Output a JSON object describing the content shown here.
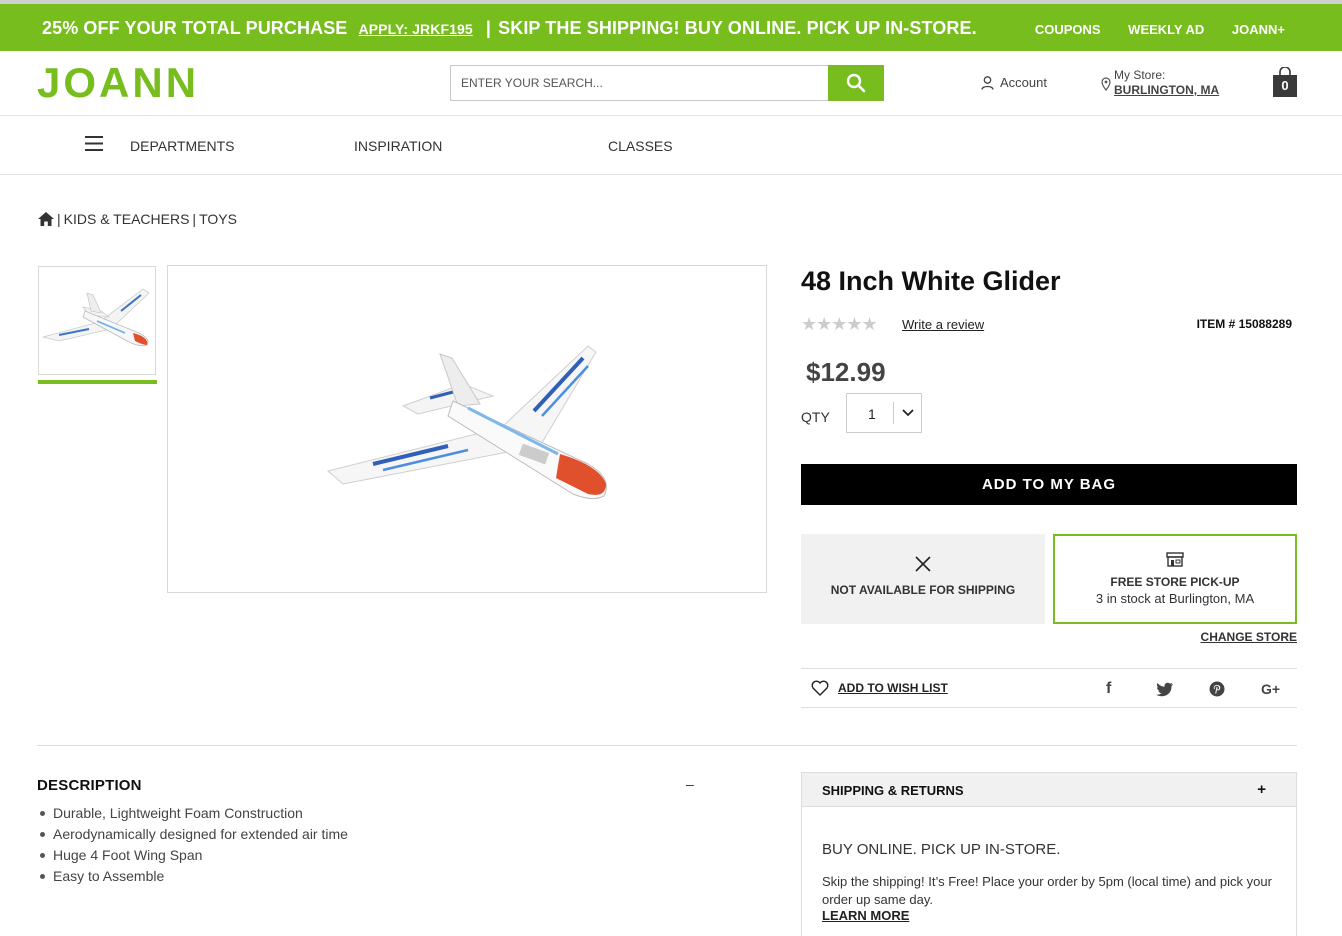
{
  "promo": {
    "main_text": "25% OFF YOUR TOTAL PURCHASE",
    "apply_code": "APPLY: JRKF195",
    "separator": "|",
    "shipping_text": "SKIP THE SHIPPING! BUY ONLINE. PICK UP IN-STORE.",
    "links": [
      "COUPONS",
      "WEEKLY AD",
      "JOANN+"
    ]
  },
  "header": {
    "logo": "JOANN",
    "search_placeholder": "ENTER YOUR SEARCH...",
    "account_label": "Account",
    "store_label": "My Store:",
    "store_value": "BURLINGTON, MA",
    "bag_count": "0"
  },
  "nav": {
    "items": [
      "DEPARTMENTS",
      "INSPIRATION",
      "CLASSES"
    ]
  },
  "breadcrumb": {
    "items": [
      "KIDS & TEACHERS",
      "TOYS"
    ]
  },
  "product": {
    "title": "48 Inch White Glider",
    "stars": "★★★★★",
    "rating": 0,
    "review_link": "Write a review",
    "item_number": "ITEM # 15088289",
    "price": "$12.99",
    "qty_label": "QTY",
    "qty_value": "1",
    "add_button": "ADD TO MY BAG"
  },
  "fulfillment": {
    "shipping_label": "NOT AVAILABLE FOR SHIPPING",
    "pickup_label": "FREE STORE PICK-UP",
    "pickup_stock": "3 in stock at Burlington, MA",
    "change_store": "CHANGE STORE"
  },
  "wishlist": {
    "label": "ADD TO WISH LIST",
    "social": [
      "f",
      "t",
      "p",
      "G+"
    ]
  },
  "description": {
    "heading": "DESCRIPTION",
    "toggle": "–",
    "bullets": [
      "Durable, Lightweight Foam Construction",
      "Aerodynamically designed for extended air time",
      "Huge 4 Foot Wing Span",
      "Easy to Assemble"
    ]
  },
  "shipping_returns": {
    "heading": "SHIPPING & RETURNS",
    "toggle": "+",
    "subheading": "BUY ONLINE. PICK UP IN-STORE.",
    "body": "Skip the shipping! It’s Free! Place your order by 5pm (local time) and pick your order up same day.",
    "learn_more": "LEARN MORE"
  },
  "colors": {
    "brand_green": "#76bd1d",
    "black": "#000000"
  }
}
